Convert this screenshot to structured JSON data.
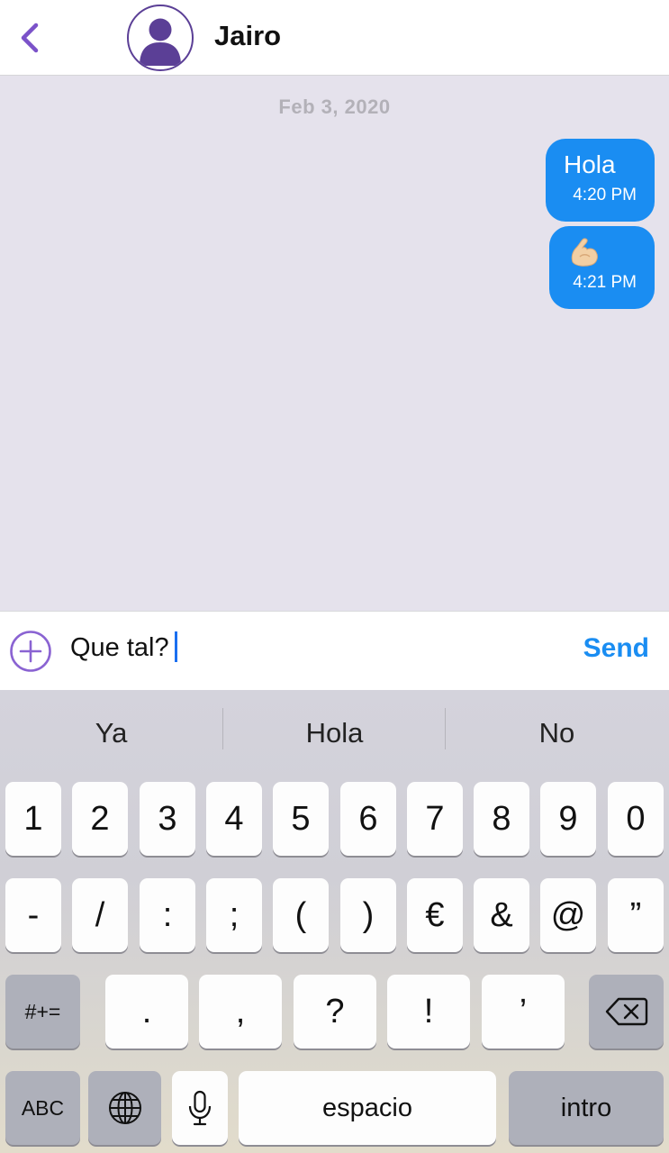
{
  "header": {
    "contact_name": "Jairo",
    "back_icon": "chevron-left-icon",
    "avatar_icon": "person-icon",
    "accent_color": "#6a3fb5"
  },
  "chat": {
    "date_separator": "Feb 3, 2020",
    "messages": [
      {
        "text": "Hola",
        "time": "4:20 PM",
        "direction": "outgoing"
      },
      {
        "text": "💪🏻",
        "time": "4:21 PM",
        "direction": "outgoing"
      }
    ],
    "bubble_color": "#1a8df2"
  },
  "composer": {
    "value": "Que tal?",
    "send_label": "Send",
    "add_icon": "plus-circle-icon"
  },
  "keyboard": {
    "suggestions": [
      "Ya",
      "Hola",
      "No"
    ],
    "row1": [
      "1",
      "2",
      "3",
      "4",
      "5",
      "6",
      "7",
      "8",
      "9",
      "0"
    ],
    "row2": [
      "-",
      "/",
      ":",
      ";",
      "(",
      ")",
      "€",
      "&",
      "@",
      "”"
    ],
    "row3_symbols_label": "#+=",
    "row3": [
      ".",
      ",",
      "?",
      "!",
      "’"
    ],
    "backspace_icon": "backspace-icon",
    "abc_label": "ABC",
    "globe_icon": "globe-icon",
    "mic_icon": "microphone-icon",
    "space_label": "espacio",
    "return_label": "intro"
  }
}
